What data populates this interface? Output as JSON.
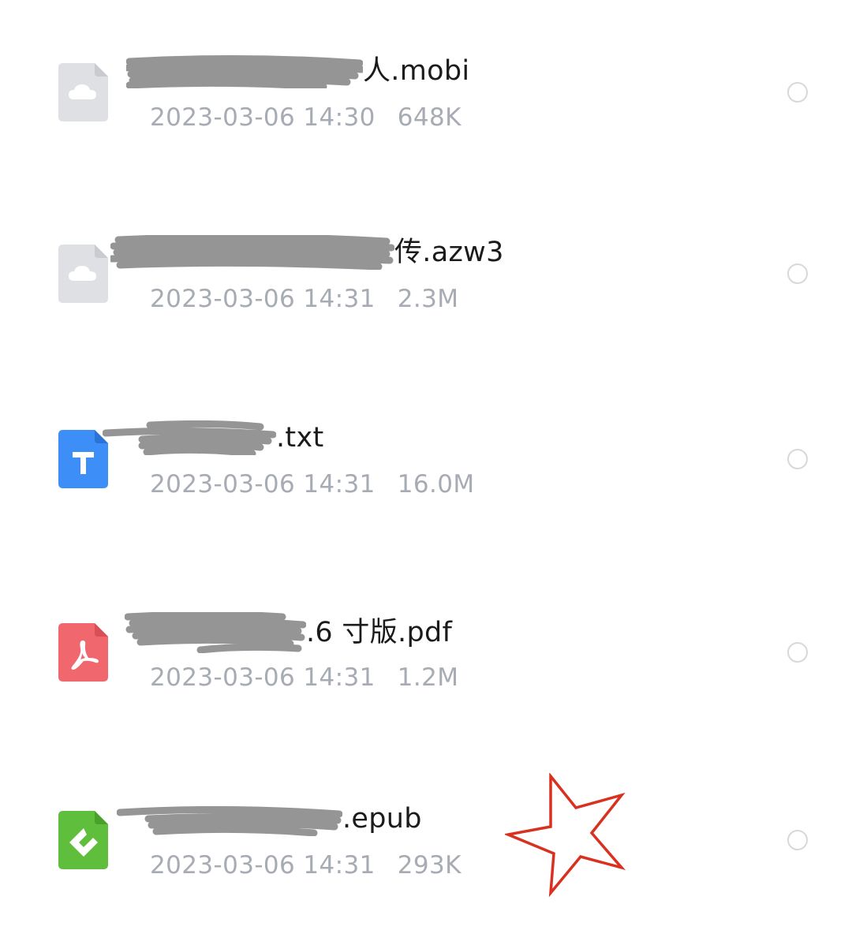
{
  "files": [
    {
      "name_visible": "人.mobi",
      "date": "2023-03-06 14:30",
      "size": "648K",
      "icon": "cloud-file-icon"
    },
    {
      "name_visible": "传.azw3",
      "date": "2023-03-06 14:31",
      "size": "2.3M",
      "icon": "cloud-file-icon"
    },
    {
      "name_visible": ".txt",
      "date": "2023-03-06 14:31",
      "size": "16.0M",
      "icon": "txt-file-icon"
    },
    {
      "name_visible": ".6 寸版.pdf",
      "date": "2023-03-06 14:31",
      "size": "1.2M",
      "icon": "pdf-file-icon"
    },
    {
      "name_visible": ".epub",
      "date": "2023-03-06 14:31",
      "size": "293K",
      "icon": "epub-file-icon"
    }
  ],
  "annotation": {
    "shape": "star",
    "color": "#d9301f"
  },
  "colors": {
    "filename": "#1b1b1b",
    "meta": "#a7abb3",
    "radio": "#d6d8dc",
    "scribble": "#8f8f8f",
    "cloud_icon": "#dfe0e4",
    "txt_icon": "#3d8ff7",
    "pdf_icon": "#f0686e",
    "epub_icon": "#5fbe3b"
  }
}
